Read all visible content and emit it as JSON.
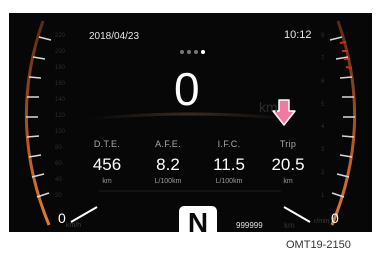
{
  "status_bar": {
    "date": "2018/04/23",
    "time": "10:12"
  },
  "page_dots": {
    "count": 4,
    "active_index": 3
  },
  "speed": {
    "value": "0",
    "unit_ghost": "km"
  },
  "readouts": [
    {
      "label": "D.T.E.",
      "value": "456",
      "unit": "km"
    },
    {
      "label": "A.F.E.",
      "value": "8.2",
      "unit": "L/100km"
    },
    {
      "label": "I.F.C.",
      "value": "11.5",
      "unit": "L/100km"
    },
    {
      "label": "Trip",
      "value": "20.5",
      "unit": "km"
    }
  ],
  "gear": "N",
  "odometer": {
    "value": "999999",
    "unit_ghost": "km"
  },
  "left_gauge": {
    "label": "0",
    "unit_ghost": "km/h",
    "scale_ghost": [
      "220",
      "200",
      "180",
      "160",
      "140",
      "120",
      "100",
      "80",
      "60",
      "40",
      "20"
    ]
  },
  "right_gauge": {
    "label": "0",
    "unit_ghost": "r/min",
    "scale_ghost": [
      "8",
      "7",
      "6",
      "5",
      "4",
      "3",
      "2",
      "1"
    ]
  },
  "caption": "OMT19-2150",
  "colors": {
    "accent_gauge": "#c0602a",
    "redline": "#d42a1a",
    "pointer_arrow": "#f07aa0"
  }
}
